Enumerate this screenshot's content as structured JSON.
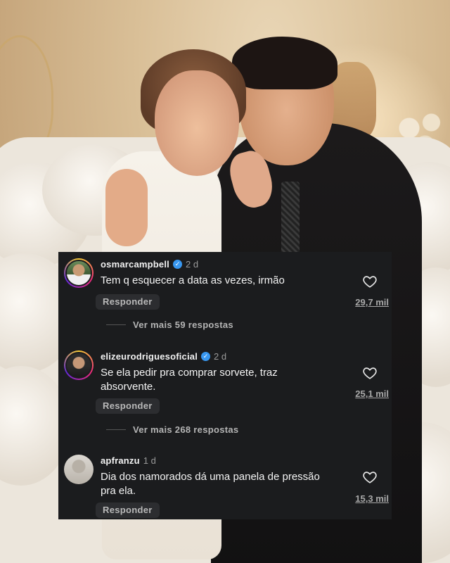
{
  "comments": [
    {
      "username": "osmarcampbell",
      "verified": true,
      "time": "2 d",
      "text": "Tem q esquecer a data as vezes, irmão",
      "reply_label": "Responder",
      "likes": "29,7 mil",
      "more_replies": "Ver mais 59 respostas"
    },
    {
      "username": "elizeurodriguesoficial",
      "verified": true,
      "time": "2 d",
      "text": "Se ela pedir pra comprar sorvete, traz absorvente.",
      "reply_label": "Responder",
      "likes": "25,1 mil",
      "more_replies": "Ver mais 268 respostas"
    },
    {
      "username": "apfranzu",
      "verified": false,
      "time": "1 d",
      "text": "Dia dos namorados dá uma panela de pressão pra ela.",
      "reply_label": "Responder",
      "likes": "15,3 mil"
    }
  ],
  "icons": {
    "verified": "verified-badge-icon",
    "like": "heart-icon"
  },
  "colors": {
    "panel_bg": "#1b1c1e",
    "verified": "#3897f0",
    "story_ring": [
      "#f9ce34",
      "#ee2a7b",
      "#6228d7"
    ]
  }
}
